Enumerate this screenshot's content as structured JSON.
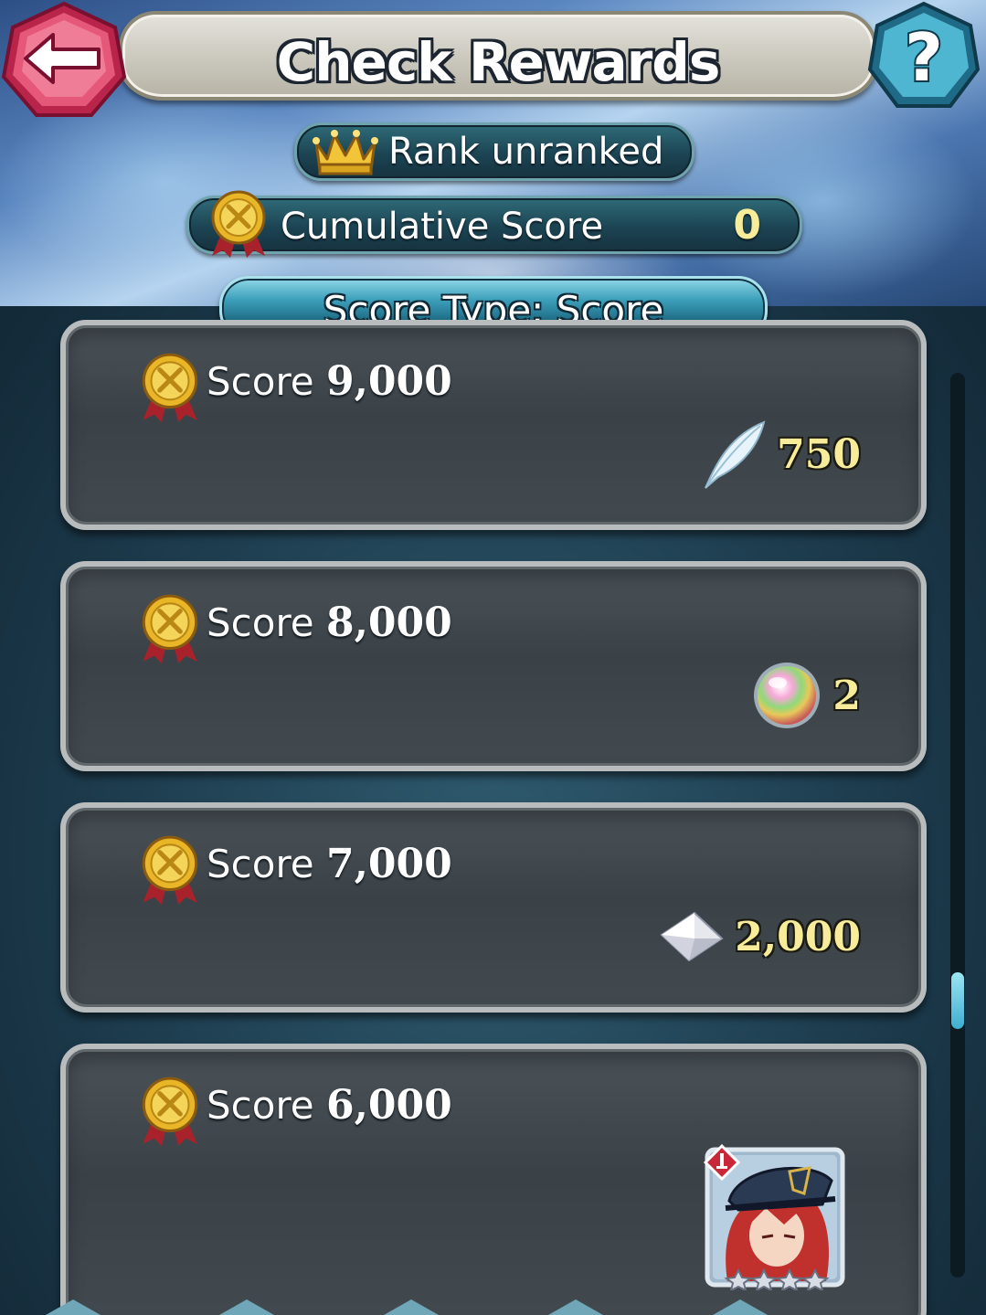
{
  "header": {
    "title": "Check Rewards",
    "back_icon": "back-arrow-icon",
    "help_icon": "help-question-icon"
  },
  "rank": {
    "label": "Rank  unranked",
    "icon": "crown-icon"
  },
  "cumulative": {
    "label": "Cumulative Score",
    "value": "0",
    "icon": "gold-medal-icon"
  },
  "score_type": {
    "label": "Score Type: Score"
  },
  "rewards": [
    {
      "score_word": "Score",
      "score_value": "9,000",
      "reward_icon": "feather-icon",
      "reward_value": "750"
    },
    {
      "score_word": "Score",
      "score_value": "8,000",
      "reward_icon": "orb-icon",
      "reward_value": "2"
    },
    {
      "score_word": "Score",
      "score_value": "7,000",
      "reward_icon": "crystal-icon",
      "reward_value": "2,000"
    },
    {
      "score_word": "Score",
      "score_value": "6,000",
      "reward_icon": "hero-portrait-icon",
      "reward_value": ""
    }
  ],
  "colors": {
    "accent_gold": "#f6ec9a",
    "panel": "#3a4248",
    "back_button": "#e0506c",
    "help_button": "#3aa6c4"
  },
  "scroll": {
    "position_fraction": 0.66
  }
}
